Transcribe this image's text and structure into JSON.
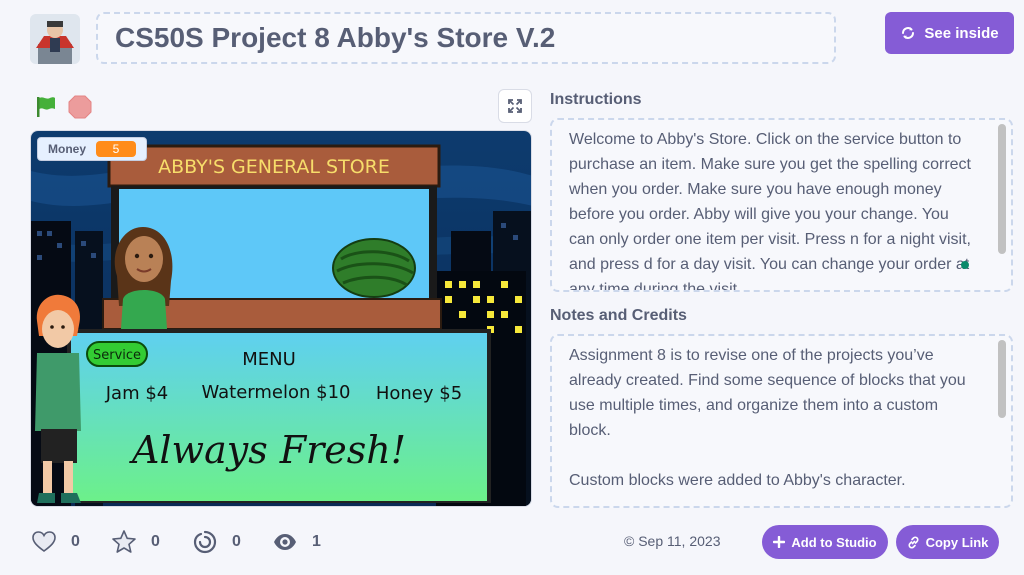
{
  "project": {
    "title": "CS50S Project 8 Abby's Store V.2",
    "see_inside_label": "See inside"
  },
  "stage": {
    "monitor_label": "Money",
    "monitor_value": "5",
    "store_sign": "ABBY'S GENERAL STORE",
    "service_label": "Service",
    "menu_title": "MENU",
    "menu_items": [
      "Jam $4",
      "Watermelon $10",
      "Honey $5"
    ],
    "slogan": "Always Fresh!"
  },
  "instructions": {
    "heading": "Instructions",
    "text": "Welcome to Abby's Store. Click on the service button to purchase an item. Make sure you get the spelling correct when you order. Make sure you have enough money before you order. Abby will give you your change. You can only order one item per visit. Press n for a night visit, and press d for a day visit. You can change your order at any time during the visit."
  },
  "notes": {
    "heading": "Notes and Credits",
    "paragraph1": "Assignment 8 is to revise one of the projects you’ve already created. Find some sequence of blocks that you use multiple times, and organize them into a custom block.",
    "paragraph2": "Custom blocks were added to Abby's character."
  },
  "stats": {
    "loves": "0",
    "favorites": "0",
    "remixes": "0",
    "views": "1"
  },
  "footer": {
    "date": "Sep 11, 2023",
    "add_to_studio_label": "Add to Studio",
    "copy_link_label": "Copy Link"
  },
  "colors": {
    "accent": "#855cd6",
    "text": "#575e75",
    "monitor_value": "#ff8c1a",
    "green_flag": "#45b03a",
    "stop": "#ec9c9c"
  },
  "icons": [
    "green-flag-icon",
    "stop-icon",
    "fullscreen-icon",
    "see-inside-icon",
    "heart-icon",
    "star-icon",
    "remix-icon",
    "eye-icon",
    "copyright-icon",
    "plus-icon",
    "link-icon"
  ]
}
